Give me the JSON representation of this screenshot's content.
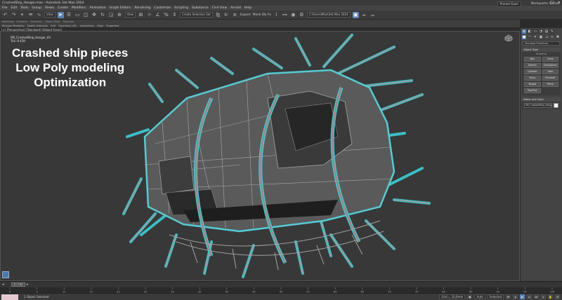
{
  "window": {
    "title": "CrashedShip_Hangar.max - Autodesk 3ds Max 2024",
    "controls": [
      "–",
      "□",
      "✕"
    ]
  },
  "menu": [
    "File",
    "Edit",
    "Tools",
    "Group",
    "Views",
    "Create",
    "Modifiers",
    "Animation",
    "Graph Editors",
    "Rendering",
    "Customize",
    "Scripting",
    "Substance",
    "Civil View",
    "Arnold",
    "Help"
  ],
  "toolbar": {
    "undo_icon": "undo-icon",
    "redo_icon": "redo-icon",
    "view_dropdown": "View",
    "selection_set": "Create Selection Set",
    "export_label": "Export",
    "mesh_label": "Mesh Ob Fo",
    "project_dropdown": "C:\\Users\\Max\\3ds Max 2024",
    "signin": "Pranne Gauri",
    "workspace_label": "Workspaces:",
    "workspace_value": "Default"
  },
  "ribbon": {
    "row1": [
      "Modeling",
      "Freeform",
      "Selection",
      "Object Paint",
      "Populate"
    ],
    "row2": [
      "Polygon Modeling",
      "Modify Selection",
      "Edit",
      "Geometry (All)",
      "Subdivision",
      "Align",
      "Properties"
    ]
  },
  "viewport": {
    "label": "[+] [Perspective] [Standard] [Edged Faces]",
    "stats_name": "SM_CrashedShip_Hangar_03",
    "stats_tris_label": "Tris:",
    "stats_tris_value": "8 439",
    "overlay_line1": "Crashed ship pieces",
    "overlay_line2": "Low Poly modeling",
    "overlay_line3": "Optimization"
  },
  "command_panel": {
    "tabs": [
      "+",
      "◧",
      "▭",
      "◔",
      "▤",
      "✎"
    ],
    "create_icons": [
      "geometry-icon",
      "shapes-icon",
      "lights-icon",
      "cameras-icon",
      "helpers-icon",
      "spacewarps-icon",
      "systems-icon"
    ],
    "category_dropdown": "Standard Primitives",
    "object_type_header": "Object Type",
    "autogrid_label": "AutoGrid",
    "object_types": [
      "Box",
      "Cone",
      "Sphere",
      "GeoSphere",
      "Cylinder",
      "Tube",
      "Torus",
      "Pyramid",
      "Teapot",
      "Plane",
      "TextPlus"
    ],
    "name_color_header": "Name and Color",
    "name_value": "SM_CrashedShip_Hangar_03",
    "swatch_color": "#f4f4f4"
  },
  "timeline": {
    "frame_display": "0 / 100",
    "ticks": [
      "0",
      "5",
      "10",
      "15",
      "20",
      "25",
      "30",
      "35",
      "40",
      "45",
      "50",
      "55",
      "60",
      "65",
      "70",
      "75",
      "80",
      "85",
      "90",
      "95",
      "100"
    ]
  },
  "status": {
    "selection": "1 Object Selected",
    "grid": "Grid = 10,0mm",
    "auto_label": "Auto",
    "selected_label": "Selected",
    "swatch_color": "#e6c9d0"
  },
  "colors": {
    "selection_outline": "#3fd6e0",
    "wireframe": "#a8a8a8",
    "mesh_fill": "#5c5c5c",
    "accent": "#5b82b6"
  }
}
